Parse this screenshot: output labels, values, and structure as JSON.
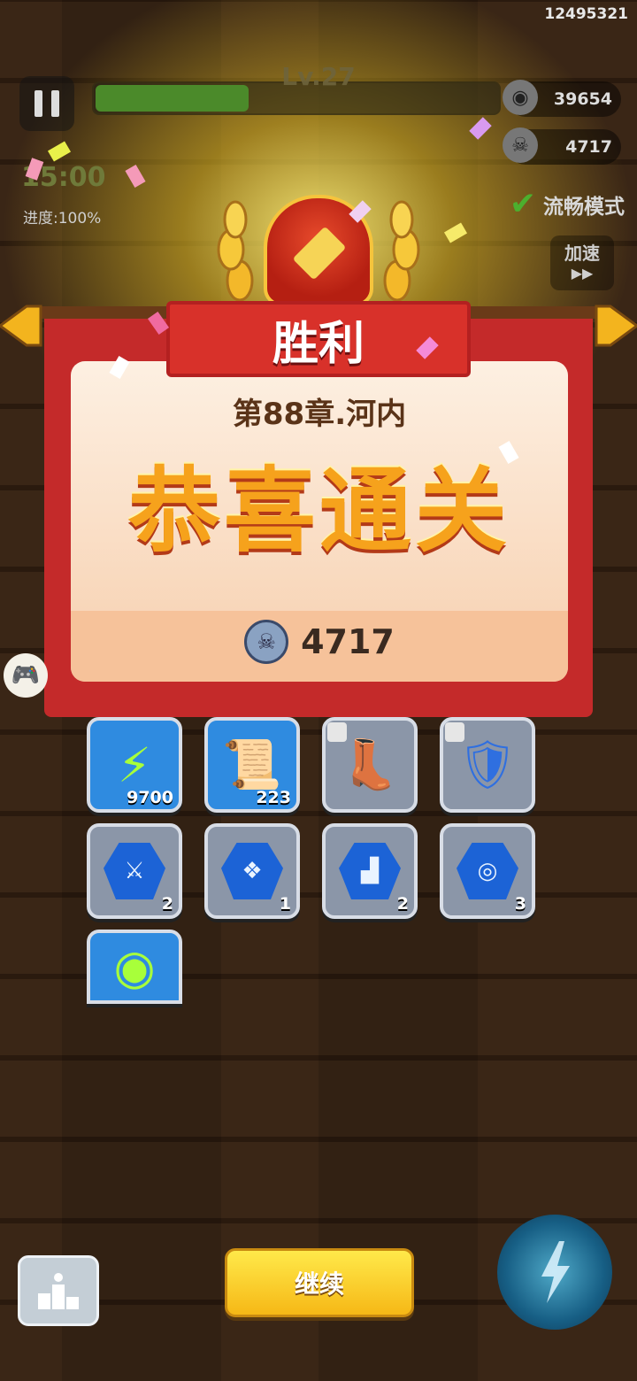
{
  "player": {
    "id": "12495321"
  },
  "hud": {
    "level": "Lv.27",
    "level_progress": 0.38,
    "coins": "39654",
    "skulls": "4717",
    "timer": "15:00",
    "progress": "进度:100%",
    "smooth_mode": "流畅模式",
    "speed_label": "加速",
    "speed_icon": "▶▶"
  },
  "result": {
    "title": "胜利",
    "chapter": "第88章.河内",
    "congrats": "恭喜通关",
    "skull_reward": "4717"
  },
  "rewards": [
    {
      "icon": "energy-bolt-icon",
      "count": "9700",
      "style": "blue"
    },
    {
      "icon": "scroll-icon",
      "count": "223",
      "style": "blue"
    },
    {
      "icon": "boots-icon",
      "count": "",
      "style": "gray"
    },
    {
      "icon": "armor-icon",
      "count": "",
      "style": "gray"
    },
    {
      "icon": "weapon-gem-icon",
      "count": "2",
      "style": "gray"
    },
    {
      "icon": "armor-gem-icon",
      "count": "1",
      "style": "gray"
    },
    {
      "icon": "boot-gem-icon",
      "count": "2",
      "style": "gray"
    },
    {
      "icon": "medal-gem-icon",
      "count": "3",
      "style": "gray"
    },
    {
      "icon": "silver-coin-icon",
      "count": "",
      "style": "blue"
    }
  ],
  "buttons": {
    "continue": "继续"
  },
  "colors": {
    "accent_red": "#c42a2a",
    "gold": "#f6b816",
    "reward_blue": "#2f8be0"
  }
}
